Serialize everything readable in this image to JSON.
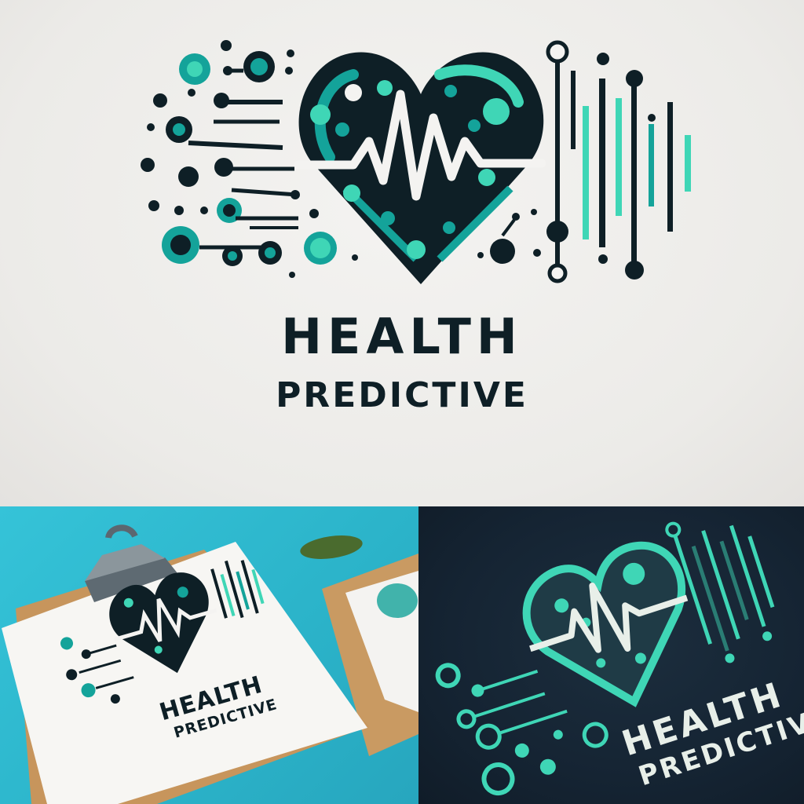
{
  "brand": {
    "word_1": "HEALTH",
    "word_2": "PREDICTIVE"
  },
  "palette": {
    "navy": "#0e1f26",
    "teal": "#14a39a",
    "mint": "#3fd6b6",
    "background": "#efedeb",
    "clipboard_background": "#30bcd2",
    "fabric_background": "#172737"
  },
  "icons": [
    "heart-icon",
    "pulse-line-icon",
    "circuit-node-icon",
    "binder-clip-icon",
    "clipboard-icon"
  ],
  "mockups": [
    {
      "kind": "clipboard",
      "label_1": "HEALTH",
      "label_2": "PREDICTIVE"
    },
    {
      "kind": "fabric",
      "label_1": "HEALTH",
      "label_2": "PREDICTIVE"
    }
  ]
}
